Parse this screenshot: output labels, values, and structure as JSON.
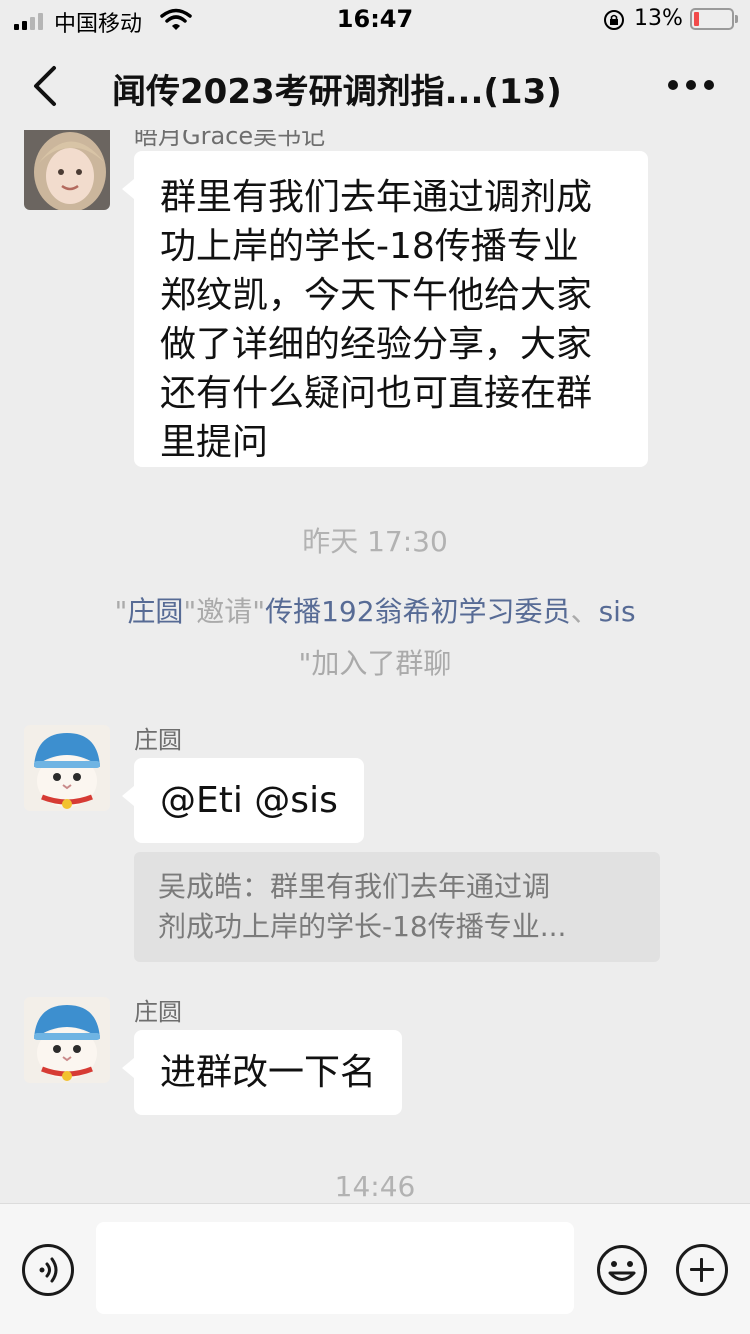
{
  "status_bar": {
    "carrier": "中国移动",
    "time": "16:47",
    "battery_percent": "13%",
    "battery_level": 0.13,
    "icons": [
      "signal-icon",
      "wifi-icon",
      "orientation-lock-icon",
      "battery-icon"
    ]
  },
  "nav": {
    "title": "闻传2023考研调剂指...(13)",
    "back_icon": "chevron-left-icon",
    "more_icon": "more-dots-icon"
  },
  "messages": {
    "m1": {
      "sender": "晤月Grace吴书记",
      "text": "群里有我们去年通过调剂成\n功上岸的学长-18传播专业\n郑纹凯，今天下午他给大家\n做了详细的经验分享，大家\n还有什么疑问也可直接在群\n里提问"
    },
    "time1": "昨天 17:30",
    "system": {
      "q1": "\"",
      "inviter": "庄圆",
      "q2": "\"邀请\"",
      "invitee1": "传播192翁希初学习委员",
      "sep": "、",
      "invitee2": "sis",
      "tail": "\"加入了群聊"
    },
    "m2": {
      "sender": "庄圆",
      "text": "@Eti @sis",
      "quote": "吴成皓：群里有我们去年通过调\n剂成功上岸的学长-18传播专业..."
    },
    "m3": {
      "sender": "庄圆",
      "text": "进群改一下名"
    },
    "time2": "14:46"
  },
  "input_bar": {
    "value": "",
    "placeholder": "",
    "icons": [
      "voice-icon",
      "emoji-icon",
      "plus-icon"
    ]
  },
  "colors": {
    "background": "#ededed",
    "bubble": "#ffffff",
    "link_name": "#576b95",
    "timestamp": "#b2b2b2",
    "quote_bg": "#e1e1e1",
    "battery_low": "#f24b4b"
  }
}
